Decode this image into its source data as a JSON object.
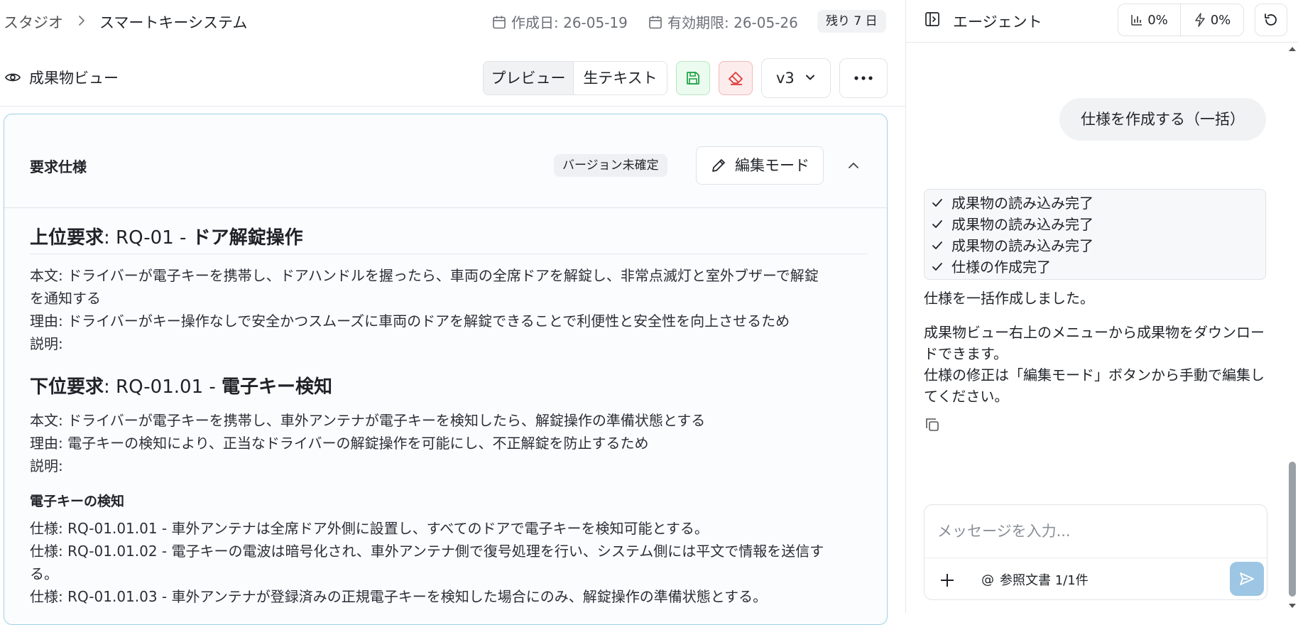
{
  "breadcrumb": {
    "root": "スタジオ",
    "current": "スマートキーシステム"
  },
  "meta": {
    "created": "作成日: 26-05-19",
    "expires": "有効期限: 26-05-26",
    "remaining": "残り 7 日"
  },
  "viewbar": {
    "title": "成果物ビュー",
    "tabs": [
      "プレビュー",
      "生テキスト"
    ],
    "version": "v3"
  },
  "card": {
    "title": "要求仕様",
    "badge": "バージョン未確定",
    "edit_label": "編集モード"
  },
  "content": {
    "h1": {
      "prefix": "上位要求",
      "rest": ": RQ-01 - ",
      "name": "ドア解錠操作"
    },
    "h1_lines": [
      "本文: ドライバーが電子キーを携帯し、ドアハンドルを握ったら、車両の全席ドアを解錠し、非常点滅灯と室外ブザーで解錠",
      "を通知する",
      "理由: ドライバーがキー操作なしで安全かつスムーズに車両のドアを解錠できることで利便性と安全性を向上させるため",
      "説明:"
    ],
    "h2": {
      "prefix": "下位要求",
      "rest": ": RQ-01.01 - ",
      "name": "電子キー検知"
    },
    "h2_lines": [
      "本文: ドライバーが電子キーを携帯し、車外アンテナが電子キーを検知したら、解錠操作の準備状態とする",
      "理由: 電子キーの検知により、正当なドライバーの解錠操作を可能にし、不正解錠を防止するため",
      "説明:"
    ],
    "h3": "電子キーの検知",
    "spec_lines": [
      "仕様: RQ-01.01.01 - 車外アンテナは全席ドア外側に設置し、すべてのドアで電子キーを検知可能とする。",
      "仕様: RQ-01.01.02 - 電子キーの電波は暗号化され、車外アンテナ側で復号処理を行い、システム側には平文で情報を送信す",
      "る。",
      "仕様: RQ-01.01.03 - 車外アンテナが登録済みの正規電子キーを検知した場合にのみ、解錠操作の準備状態とする。"
    ]
  },
  "agent": {
    "title": "エージェント",
    "usage_1": "0%",
    "usage_2": "0%",
    "user_message": "仕様を作成する（一括）",
    "steps": [
      "成果物の読み込み完了",
      "成果物の読み込み完了",
      "成果物の読み込み完了",
      "仕様の作成完了"
    ],
    "reply_1": "仕様を一括作成しました。",
    "reply_2": "成果物ビュー右上のメニューから成果物をダウンロードできます。",
    "reply_3": "仕様の修正は「編集モード」ボタンから手動で編集してください。",
    "input_placeholder": "メッセージを入力...",
    "reference": "参照文書 1/1件"
  },
  "colors": {
    "accent_border": "#9fd0e8",
    "save_green": "#22a447",
    "erase_red": "#e03a3a",
    "send_blue": "#9cc6e3"
  }
}
